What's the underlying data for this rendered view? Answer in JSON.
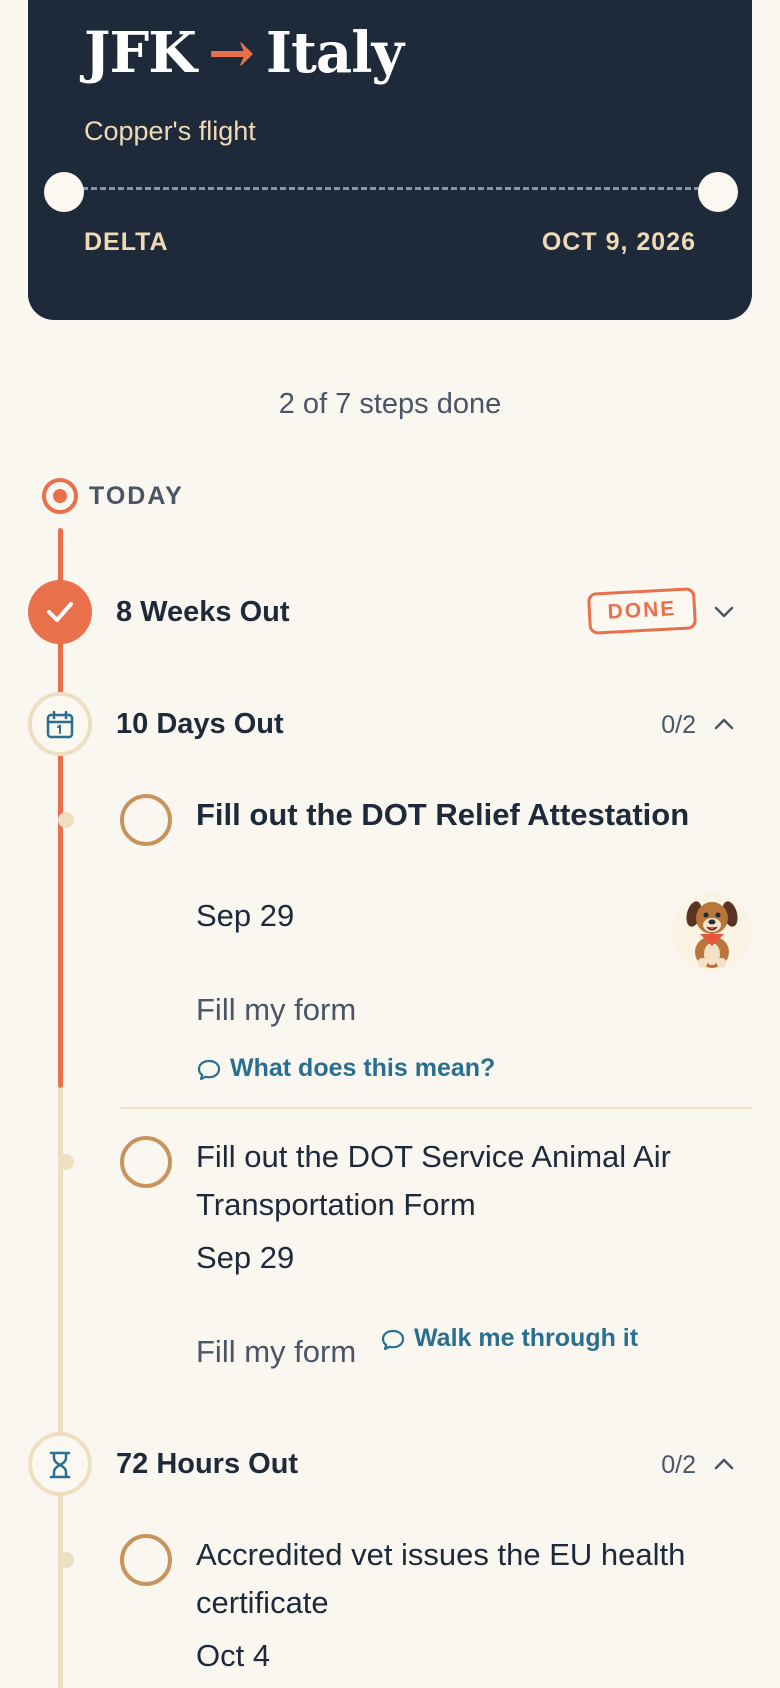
{
  "trip": {
    "origin": "JFK",
    "arrow": "→",
    "destination": "Italy",
    "subtitle": "Copper's flight",
    "airline": "DELTA",
    "date": "OCT 9, 2026"
  },
  "progress": {
    "text": "2 of 7 steps done",
    "done": 2,
    "total": 7
  },
  "today_label": "TODAY",
  "milestones": [
    {
      "title": "8 Weeks Out",
      "badge": "DONE",
      "icon": "check-icon",
      "expanded": false
    },
    {
      "title": "10 Days Out",
      "count": "0/2",
      "icon": "calendar-icon",
      "expanded": true,
      "tasks": [
        {
          "title": "Fill out the DOT Relief Attestation",
          "date": "Sep 29",
          "action": "Fill my form",
          "help": "What does this mean?"
        },
        {
          "title": "Fill out the DOT Service Animal Air Transportation Form",
          "date": "Sep 29",
          "action": "Fill my form",
          "help": "Walk me through it"
        }
      ]
    },
    {
      "title": "72 Hours Out",
      "count": "0/2",
      "icon": "hourglass-icon",
      "expanded": true,
      "tasks": [
        {
          "title": "Accredited vet issues the EU health certificate",
          "date": "Oct 4"
        }
      ]
    }
  ],
  "colors": {
    "navy": "#1e2a3a",
    "accent": "#e8704a",
    "cream": "#faf6f0",
    "beige": "#eedfc3",
    "link": "#2a6f8f",
    "task_ring": "#c8945e"
  }
}
